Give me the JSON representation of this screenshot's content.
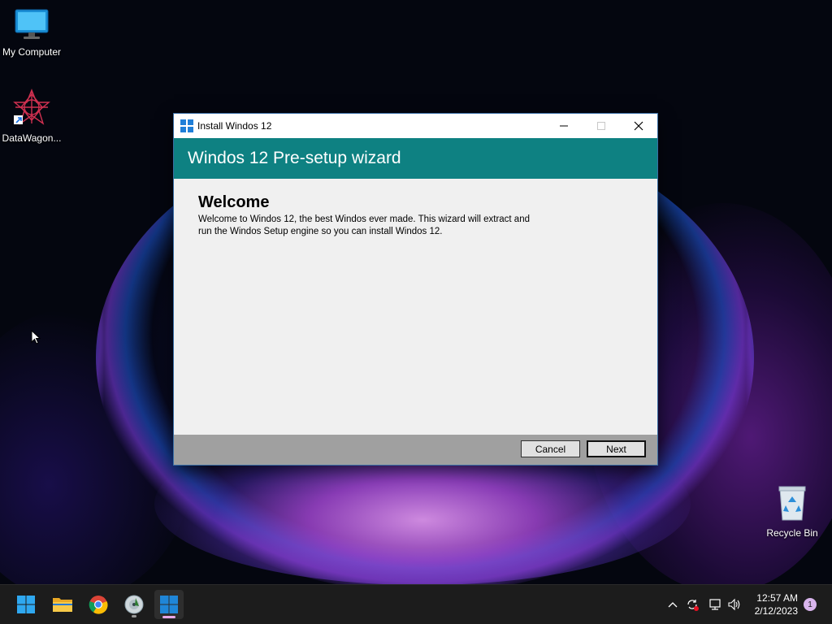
{
  "desktop": {
    "icons": [
      {
        "label": "My Computer",
        "icon": "monitor-icon"
      },
      {
        "label": "DataWagon...",
        "icon": "star-burst-icon"
      },
      {
        "label": "Recycle Bin",
        "icon": "recycle-bin-icon"
      }
    ]
  },
  "dialog": {
    "title": "Install Windos 12",
    "header": "Windos 12 Pre-setup wizard",
    "heading": "Welcome",
    "body": "Welcome to Windos 12, the best Windos ever made. This wizard will extract and run the Windos Setup engine so you can install Windos 12.",
    "buttons": {
      "cancel": "Cancel",
      "next": "Next"
    },
    "accent": "#0e8182"
  },
  "taskbar": {
    "apps": [
      "start-icon",
      "file-explorer-icon",
      "chrome-icon",
      "disc-app-icon",
      "windos-setup-icon"
    ],
    "tray": [
      "chevron-up-icon",
      "sync-icon",
      "network-icon",
      "volume-icon"
    ],
    "clock": {
      "time": "12:57 AM",
      "date": "2/12/2023"
    },
    "notifications": "1"
  }
}
